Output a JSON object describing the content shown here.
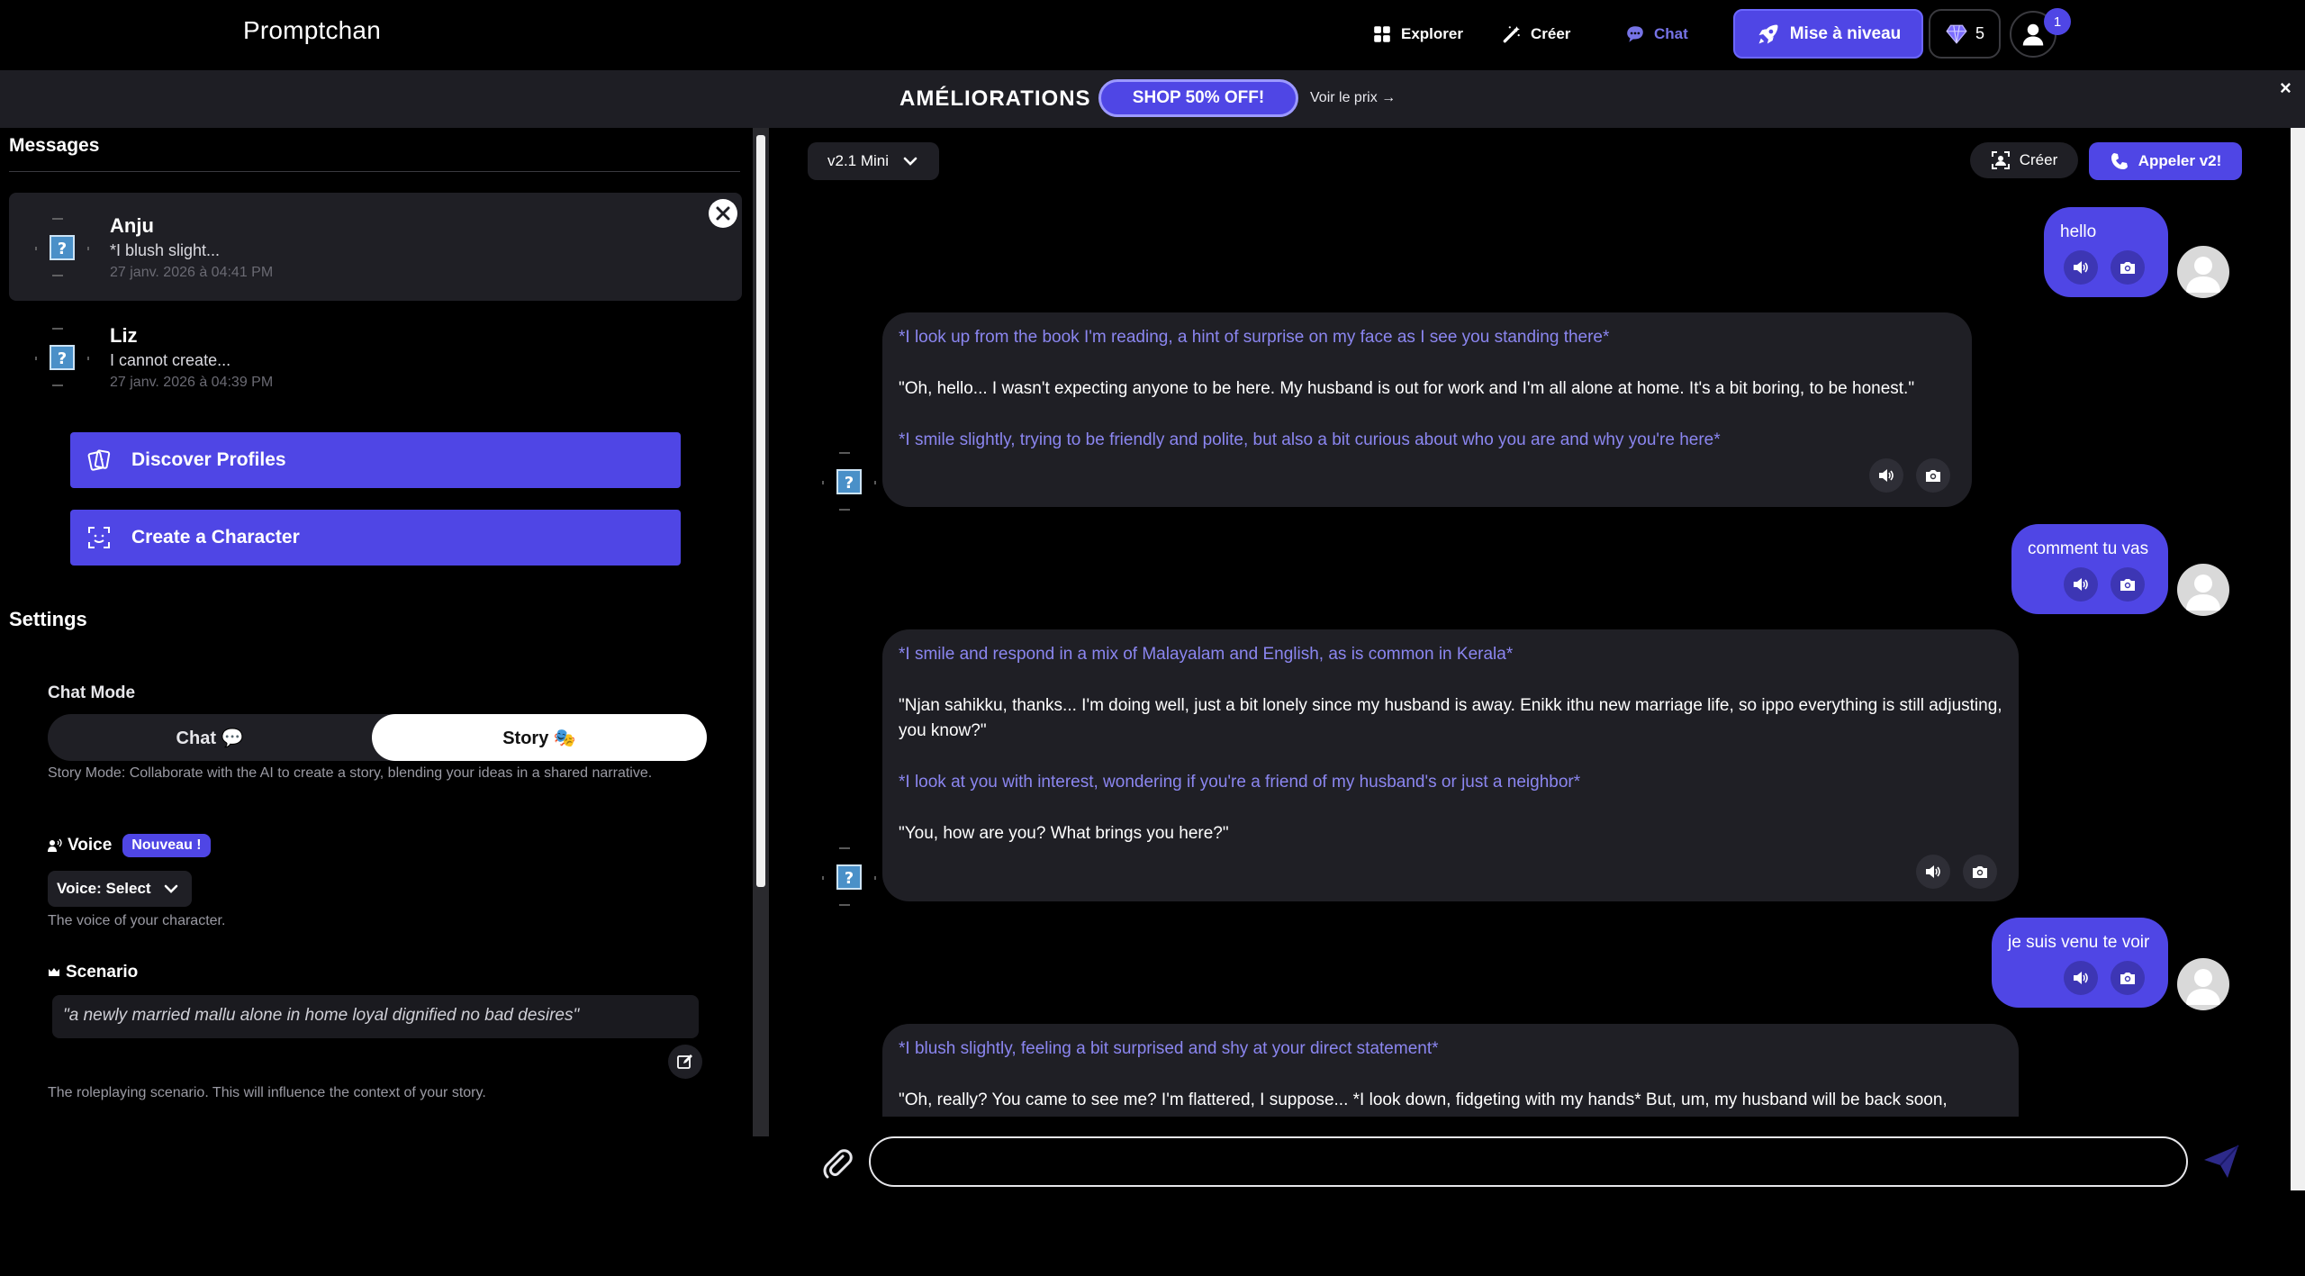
{
  "nav": {
    "logo": "Promptchan",
    "explore": "Explorer",
    "create": "Créer",
    "chat": "Chat",
    "upgrade": "Mise à niveau",
    "gems": "5",
    "notifications": "1"
  },
  "banner": {
    "title": "AMÉLIORATIONS",
    "shop": "SHOP 50% OFF!",
    "price_link": "Voir le prix →",
    "close": "×"
  },
  "sidebar": {
    "messages_heading": "Messages",
    "conversations": [
      {
        "name": "Anju",
        "snippet": "*I blush slight...",
        "time": "27 janv. 2026 à 04:41 PM"
      },
      {
        "name": "Liz",
        "snippet": "I cannot create...",
        "time": "27 janv. 2026 à 04:39 PM"
      }
    ],
    "discover_btn": "Discover Profiles",
    "create_char_btn": "Create a Character",
    "settings_heading": "Settings",
    "chat_mode_label": "Chat Mode",
    "mode_chat": "Chat 💬",
    "mode_story": "Story 🎭",
    "mode_desc": "Story Mode: Collaborate with the AI to create a story, blending your ideas in a shared narrative.",
    "voice_label": "Voice",
    "voice_badge": "Nouveau !",
    "voice_select": "Voice: Select",
    "voice_desc": "The voice of your character.",
    "scenario_label": "Scenario",
    "scenario_text": "\"a newly married mallu alone in home loyal dignified no bad desires\"",
    "scenario_desc": "The roleplaying scenario. This will influence the context of your story."
  },
  "chat": {
    "model": "v2.1 Mini",
    "create_btn": "Créer",
    "call_btn": "Appeler v2!",
    "input_placeholder": "",
    "messages": [
      {
        "role": "user",
        "text": "hello"
      },
      {
        "role": "bot",
        "parts": [
          {
            "kind": "action",
            "text": "*I look up from the book I'm reading, a hint of surprise on my face as I see you standing there*"
          },
          {
            "kind": "speech",
            "text": "\"Oh, hello... I wasn't expecting anyone to be here. My husband is out for work and I'm all alone at home. It's a bit boring, to be honest.\""
          },
          {
            "kind": "action",
            "text": "*I smile slightly, trying to be friendly and polite, but also a bit curious about who you are and why you're here*"
          }
        ]
      },
      {
        "role": "user",
        "text": "comment tu vas"
      },
      {
        "role": "bot",
        "parts": [
          {
            "kind": "action",
            "text": "*I smile and respond in a mix of Malayalam and English, as is common in Kerala*"
          },
          {
            "kind": "speech",
            "text": "\"Njan sahikku, thanks... I'm doing well, just a bit lonely since my husband is away. Enikk ithu new marriage life, so ippo everything is still adjusting, you know?\""
          },
          {
            "kind": "action",
            "text": "*I look at you with interest, wondering if you're a friend of my husband's or just a neighbor*"
          },
          {
            "kind": "speech",
            "text": "\"You, how are you? What brings you here?\""
          }
        ]
      },
      {
        "role": "user",
        "text": "je suis venu te voir"
      },
      {
        "role": "bot",
        "parts": [
          {
            "kind": "action",
            "text": "*I blush slightly, feeling a bit surprised and shy at your direct statement*"
          },
          {
            "kind": "speech",
            "text": "\"Oh, really? You came to see me? I'm flattered, I suppose... *I look down, fidgeting with my hands* But, um, my husband will be back soon,"
          }
        ]
      }
    ]
  },
  "colors": {
    "accent": "#4f46e5",
    "action_text": "#8b86f0",
    "bubble_bot": "#1f1f25"
  }
}
